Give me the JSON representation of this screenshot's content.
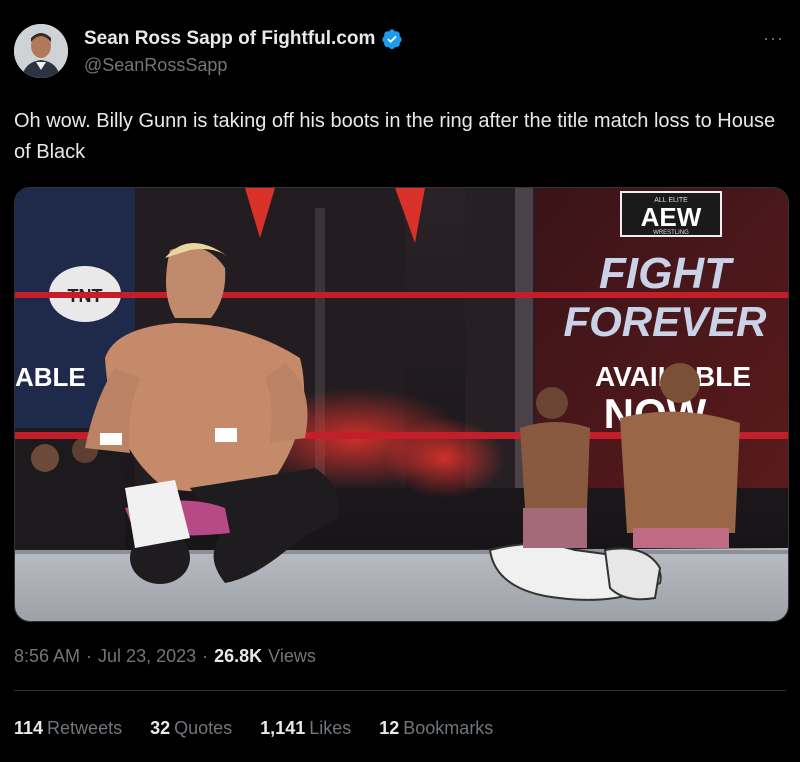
{
  "author": {
    "display_name": "Sean Ross Sapp of Fightful.com",
    "handle": "@SeanRossSapp",
    "verified_badge_color": "#1d9bf0"
  },
  "more_label": "···",
  "tweet": {
    "text": "Oh wow. Billy Gunn is taking off his boots in the ring after the title match loss to House of Black"
  },
  "media": {
    "brand_logo": "AEW",
    "brand_top": "ALL ELITE",
    "brand_sub": "WRESTLING",
    "screen_title_1": "FIGHT",
    "screen_title_2": "FOREVER",
    "screen_available": "AVAILABLE",
    "screen_now": "NOW",
    "left_available": "ABLE",
    "tnt_logo": "TNT"
  },
  "meta": {
    "time": "8:56 AM",
    "dot1": "·",
    "date": "Jul 23, 2023",
    "dot2": "·",
    "views_count": "26.8K",
    "views_label": "Views"
  },
  "stats": {
    "retweets_count": "114",
    "retweets_label": "Retweets",
    "quotes_count": "32",
    "quotes_label": "Quotes",
    "likes_count": "1,141",
    "likes_label": "Likes",
    "bookmarks_count": "12",
    "bookmarks_label": "Bookmarks"
  }
}
